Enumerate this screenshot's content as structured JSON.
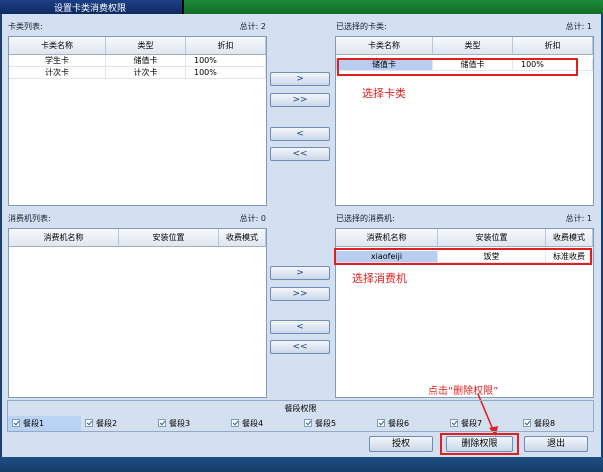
{
  "window": {
    "title": "设置卡类消费权限"
  },
  "card_types": {
    "title": "卡类列表:",
    "count": "总计: 2",
    "columns": [
      "卡类名称",
      "类型",
      "折扣"
    ],
    "rows": [
      [
        "学生卡",
        "储值卡",
        "100%"
      ],
      [
        "计次卡",
        "计次卡",
        "100%"
      ]
    ]
  },
  "selected_card_types": {
    "title": "已选择的卡类:",
    "count": "总计: 1",
    "columns": [
      "卡类名称",
      "类型",
      "折扣"
    ],
    "rows": [
      [
        "储值卡",
        "储值卡",
        "100%"
      ]
    ]
  },
  "machines": {
    "title": "消费机列表:",
    "count": "总计: 0",
    "columns": [
      "消费机名称",
      "安装位置",
      "收费模式"
    ],
    "rows": []
  },
  "selected_machines": {
    "title": "已选择的消费机:",
    "count": "总计: 1",
    "columns": [
      "消费机名称",
      "安装位置",
      "收费模式"
    ],
    "rows": [
      [
        "xiaofeiji",
        "饭堂",
        "标准收费"
      ]
    ]
  },
  "transfer_buttons": {
    "add": ">",
    "add_all": ">>",
    "remove": "<",
    "remove_all": "<<"
  },
  "annotations": {
    "select_card": "选择卡类",
    "select_machine": "选择消费机",
    "click_delete": "点击“删除权限”"
  },
  "meal_periods": {
    "title": "餐段权限",
    "items": [
      "餐段1",
      "餐段2",
      "餐段3",
      "餐段4",
      "餐段5",
      "餐段6",
      "餐段7",
      "餐段8"
    ]
  },
  "actions": {
    "grant": "授权",
    "delete": "删除权限",
    "exit": "退出"
  },
  "colors": {
    "annotation": "#e02020",
    "selection": "#b7cef0",
    "title_bar": "#0e2a63"
  }
}
